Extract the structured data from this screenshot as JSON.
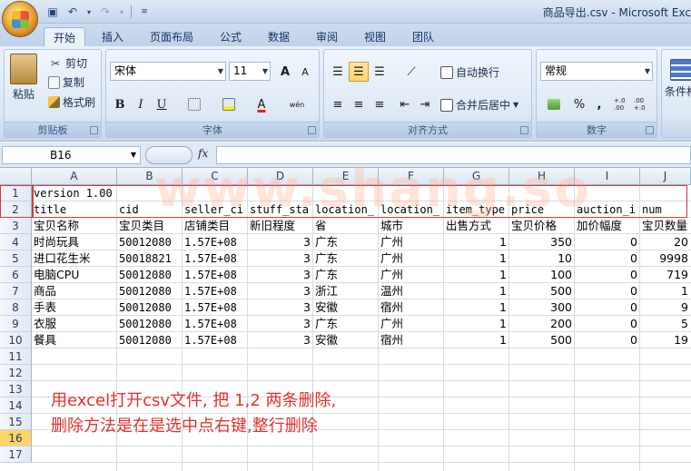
{
  "window": {
    "title": "商品导出.csv - Microsoft Exc"
  },
  "tabs": [
    "开始",
    "插入",
    "页面布局",
    "公式",
    "数据",
    "审阅",
    "视图",
    "团队"
  ],
  "ribbon": {
    "clipboard": {
      "label": "剪贴板",
      "paste": "粘贴",
      "cut": "剪切",
      "copy": "复制",
      "format_painter": "格式刷"
    },
    "font": {
      "label": "字体",
      "font_name": "宋体",
      "font_size": "11",
      "bold": "B",
      "italic": "I",
      "underline": "U",
      "grow": "A",
      "shrink": "A",
      "font_color": "A",
      "phonetic": "wén"
    },
    "alignment": {
      "label": "对齐方式",
      "wrap_text": "自动换行",
      "merge_center": "合并后居中"
    },
    "number": {
      "label": "数字",
      "format": "常规",
      "percent": "%",
      "comma": ",",
      "inc_decimal": "+.0 .00",
      "dec_decimal": ".00 +.0"
    },
    "styles": {
      "conditional": "条件格"
    }
  },
  "formula_bar": {
    "name_box": "B16",
    "fx": "fx",
    "formula": ""
  },
  "columns": [
    "A",
    "B",
    "C",
    "D",
    "E",
    "F",
    "G",
    "H",
    "I",
    "J"
  ],
  "rows": [
    "1",
    "2",
    "3",
    "4",
    "5",
    "6",
    "7",
    "8",
    "9",
    "10",
    "11",
    "12",
    "13",
    "14",
    "15",
    "16",
    "17"
  ],
  "sheet": {
    "r1": [
      "version 1.00"
    ],
    "r2": [
      "title",
      "cid",
      "seller_ci",
      "stuff_sta",
      "location_",
      "location_",
      "item_type",
      "price",
      "auction_i",
      "num"
    ],
    "r3": [
      "宝贝名称",
      "宝贝类目",
      "店铺类目",
      "新旧程度",
      "省",
      "城市",
      "出售方式",
      "宝贝价格",
      "加价幅度",
      "宝贝数量"
    ],
    "data": [
      [
        "时尚玩具",
        "50012080",
        "1.57E+08",
        "3",
        "广东",
        "广州",
        "1",
        "350",
        "0",
        "20"
      ],
      [
        "进口花生米",
        "50018821",
        "1.57E+08",
        "3",
        "广东",
        "广州",
        "1",
        "10",
        "0",
        "9998"
      ],
      [
        "电脑CPU",
        "50012080",
        "1.57E+08",
        "3",
        "广东",
        "广州",
        "1",
        "100",
        "0",
        "719"
      ],
      [
        "商品",
        "50012080",
        "1.57E+08",
        "3",
        "浙江",
        "温州",
        "1",
        "500",
        "0",
        "1"
      ],
      [
        "手表",
        "50012080",
        "1.57E+08",
        "3",
        "安徽",
        "宿州",
        "1",
        "300",
        "0",
        "9"
      ],
      [
        "衣服",
        "50012080",
        "1.57E+08",
        "3",
        "广东",
        "广州",
        "1",
        "200",
        "0",
        "5"
      ],
      [
        "餐具",
        "50012080",
        "1.57E+08",
        "3",
        "安徽",
        "宿州",
        "1",
        "500",
        "0",
        "19"
      ]
    ]
  },
  "watermark": "www.shang.so",
  "annotation": {
    "line1": "用excel打开csv文件, 把 1,2 两条删除,",
    "line2": "删除方法是在是选中点右键,整行删除"
  },
  "colors": {
    "annotation": "#e0322c",
    "highlight_box": "#d8373b",
    "selected_row_header": "#ffd46a"
  }
}
